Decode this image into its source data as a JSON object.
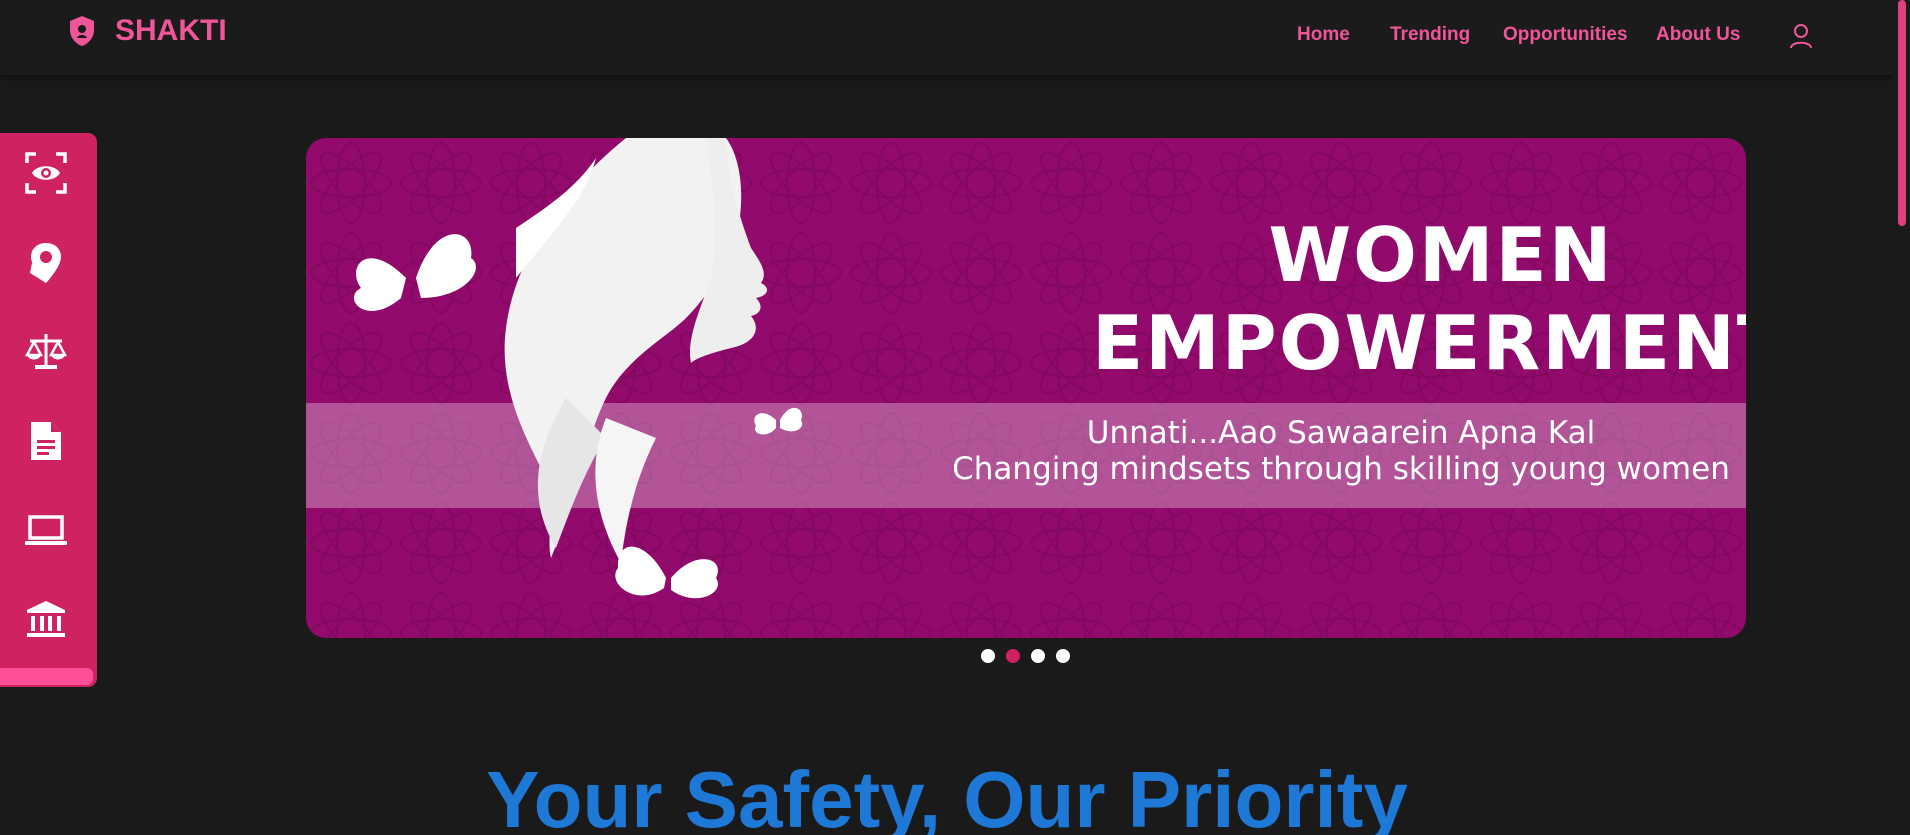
{
  "brand": {
    "name": "SHAKTI",
    "icon": "shield-icon",
    "color": "#f0559a"
  },
  "nav": {
    "links": [
      {
        "label": "Home"
      },
      {
        "label": "Trending"
      },
      {
        "label": "Opportunities"
      },
      {
        "label": "About Us"
      }
    ],
    "user_icon": "user-icon"
  },
  "sidebar": {
    "color": "#cf2262",
    "items": [
      {
        "icon": "eye-scan-icon"
      },
      {
        "icon": "location-pin-icon"
      },
      {
        "icon": "scales-icon"
      },
      {
        "icon": "document-icon"
      },
      {
        "icon": "laptop-icon"
      },
      {
        "icon": "institution-icon"
      }
    ]
  },
  "banner": {
    "title_line1": "WOMEN",
    "title_line2": "EMPOWERMENT",
    "subtitle_line1": "Unnati...Aao Sawaarein Apna Kal",
    "subtitle_line2": "Changing mindsets through skilling young women",
    "background": "#920a6c"
  },
  "carousel": {
    "total": 4,
    "active_index": 1
  },
  "heading": {
    "text": "Your Safety, Our Priority",
    "color": "#1e78d6"
  }
}
